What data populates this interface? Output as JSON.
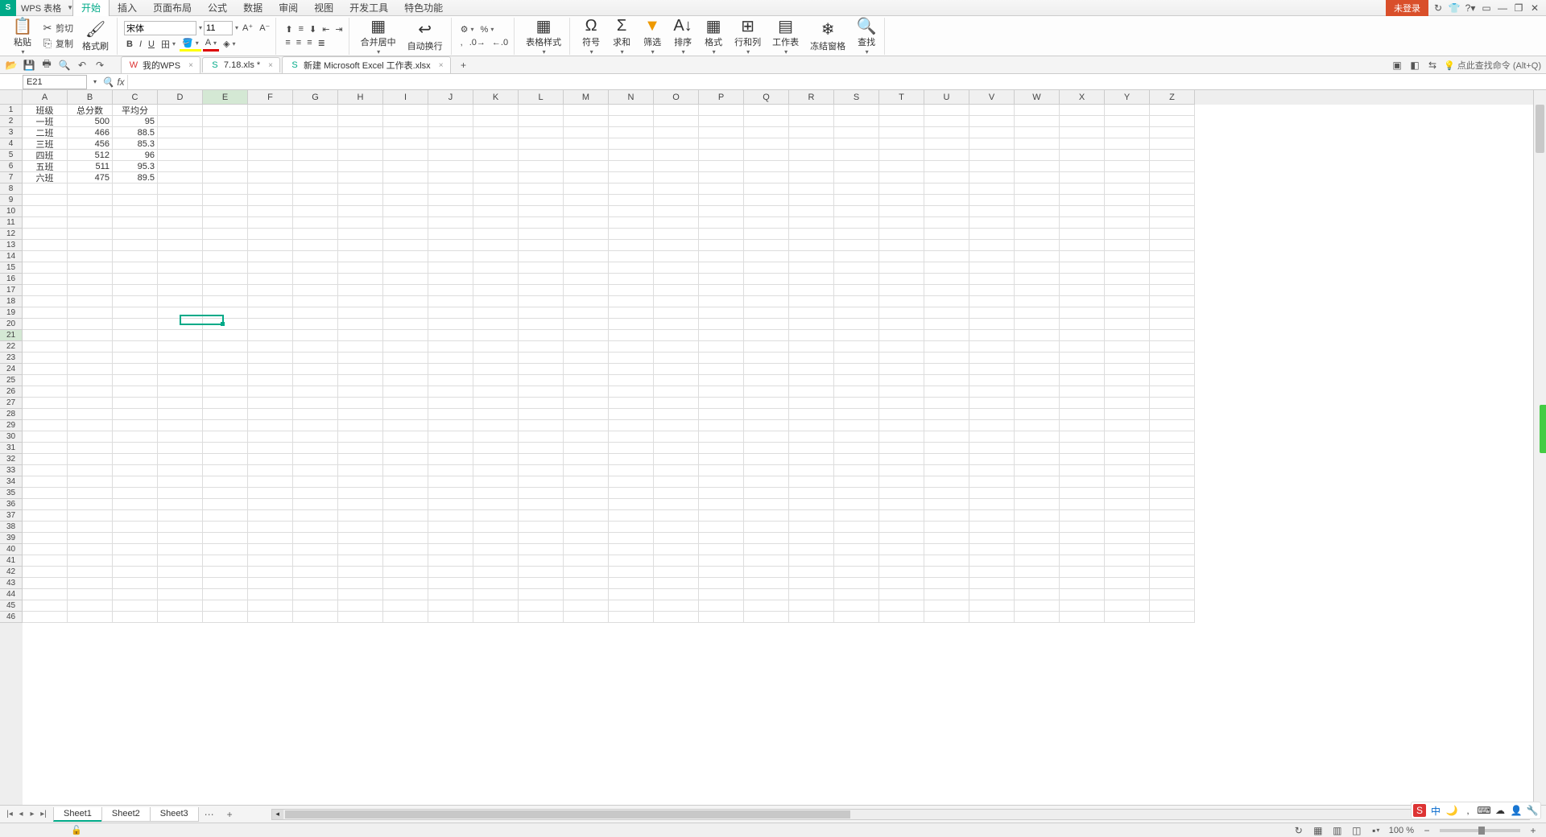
{
  "app": {
    "name": "WPS 表格",
    "login_label": "未登录"
  },
  "menutabs": [
    "开始",
    "插入",
    "页面布局",
    "公式",
    "数据",
    "审阅",
    "视图",
    "开发工具",
    "特色功能"
  ],
  "active_menutab": 0,
  "ribbon": {
    "paste": "粘贴",
    "cut": "剪切",
    "copy": "复制",
    "format_painter": "格式刷",
    "font_name": "宋体",
    "font_size": "11",
    "merge_center": "合并居中",
    "wrap_text": "自动换行",
    "cell_style": "表格样式",
    "symbol": "符号",
    "sum": "求和",
    "filter": "筛选",
    "sort": "排序",
    "format": "格式",
    "rowcol": "行和列",
    "sheet": "工作表",
    "freeze": "冻结窗格",
    "find": "查找"
  },
  "qa_search_hint": "点此查找命令 (Alt+Q)",
  "doc_tabs": [
    {
      "icon": "W",
      "label": "我的WPS",
      "color": "#d33"
    },
    {
      "icon": "S",
      "label": "7.18.xls *",
      "color": "#0a8"
    },
    {
      "icon": "S",
      "label": "新建 Microsoft Excel 工作表.xlsx",
      "color": "#0a8",
      "active": true
    }
  ],
  "name_box": "E21",
  "columns": [
    "A",
    "B",
    "C",
    "D",
    "E",
    "F",
    "G",
    "H",
    "I",
    "J",
    "K",
    "L",
    "M",
    "N",
    "O",
    "P",
    "Q",
    "R",
    "S",
    "T",
    "U",
    "V",
    "W",
    "X",
    "Y",
    "Z"
  ],
  "col_widths": {
    "default": 56,
    "A": 56,
    "B": 56,
    "C": 56
  },
  "selected_col": "E",
  "selected_row": 21,
  "num_rows": 46,
  "chart_data": {
    "type": "table",
    "headers": [
      "班级",
      "总分数",
      "平均分"
    ],
    "rows": [
      [
        "一班",
        500,
        95
      ],
      [
        "二班",
        466,
        88.5
      ],
      [
        "三班",
        456,
        85.3
      ],
      [
        "四班",
        512,
        96
      ],
      [
        "五班",
        511,
        95.3
      ],
      [
        "六班",
        475,
        89.5
      ]
    ]
  },
  "sheet_tabs": [
    "Sheet1",
    "Sheet2",
    "Sheet3"
  ],
  "active_sheet": 0,
  "zoom": "100 %"
}
